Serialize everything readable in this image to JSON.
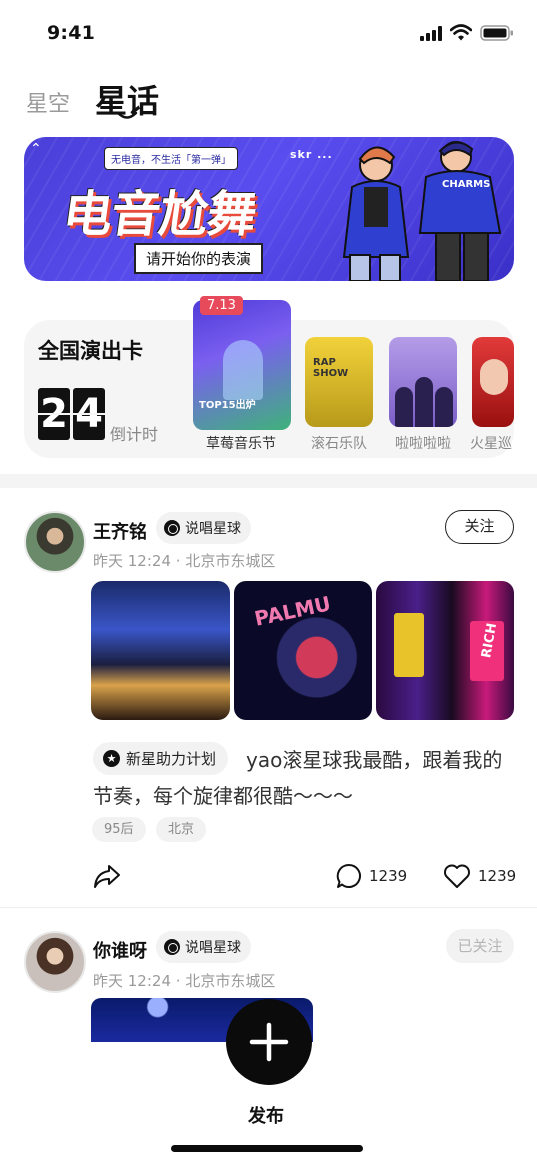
{
  "status_bar": {
    "time": "9:41"
  },
  "top_tabs": {
    "tab1": "星空",
    "tab2": "星话"
  },
  "banner": {
    "top_caption": "无电音，不生活「第一弹」",
    "title": "电音尬舞",
    "subtitle": "请开始你的表演",
    "brand": "skr ..."
  },
  "card_row": {
    "title": "全国演出卡",
    "countdown_digits": [
      "2",
      "4"
    ],
    "countdown_label": "倒计时",
    "main_poster": {
      "date": "7.13",
      "caption": "TOP15出炉",
      "label": "草莓音乐节"
    },
    "posters": [
      {
        "label": "滚石乐队",
        "caption": "RAP SHOW"
      },
      {
        "label": "啦啦啦啦"
      },
      {
        "label": "火星巡"
      }
    ]
  },
  "posts": [
    {
      "username": "王齐铭",
      "topic": "说唱星球",
      "time": "昨天 12:24",
      "location": "北京市东城区",
      "follow_label": "关注",
      "plan_tag": "新星助力计划",
      "text_line1": "yao滚星球我最酷，跟着我的",
      "text_line2": "节奏，每个旋律都很酷～～～",
      "chips": [
        "95后",
        "北京"
      ],
      "comments": "1239",
      "likes": "1239",
      "image_texts": [
        "PALMU",
        "RICH"
      ]
    },
    {
      "username": "你谁呀",
      "topic": "说唱星球",
      "time": "昨天 12:24",
      "location": "北京市东城区",
      "follow_label": "已关注"
    }
  ],
  "fab": {
    "label": "发布"
  },
  "icons": [
    "signal-icon",
    "wifi-icon",
    "battery-icon",
    "share-icon",
    "comment-icon",
    "heart-icon",
    "plus-icon",
    "star-icon",
    "planet-icon"
  ]
}
